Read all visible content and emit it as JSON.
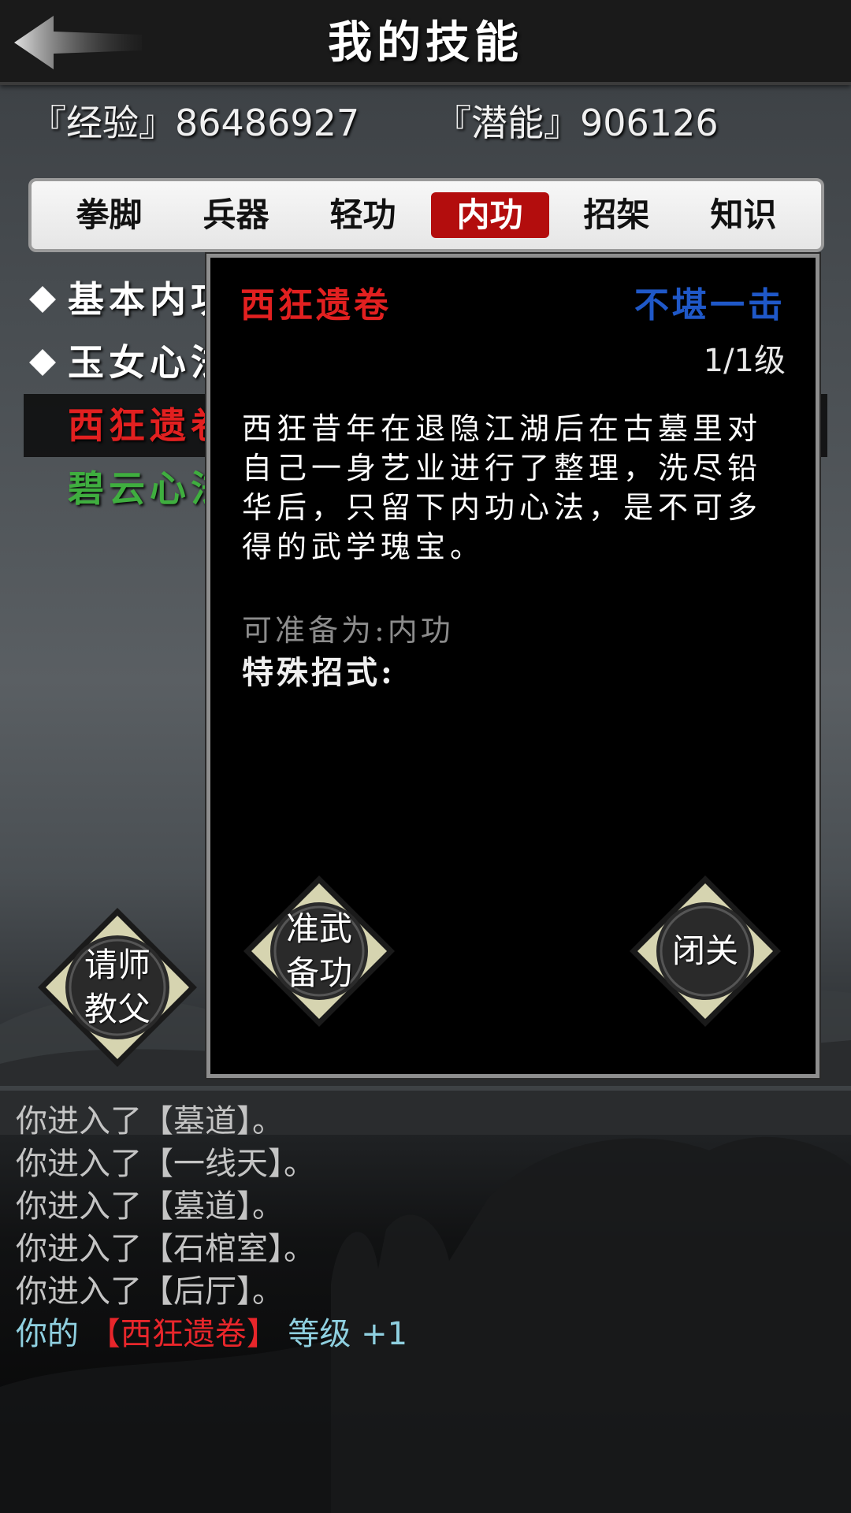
{
  "header": {
    "title": "我的技能"
  },
  "stats": {
    "experience_label": "『经验』",
    "experience_value": "86486927",
    "potential_label": "『潜能』",
    "potential_value": "906126"
  },
  "tabs": [
    {
      "label": "拳脚",
      "active": false
    },
    {
      "label": "兵器",
      "active": false
    },
    {
      "label": "轻功",
      "active": false
    },
    {
      "label": "内功",
      "active": true
    },
    {
      "label": "招架",
      "active": false
    },
    {
      "label": "知识",
      "active": false
    }
  ],
  "skills": [
    {
      "name": "基本内功",
      "color": "#ffffff",
      "bullet": true
    },
    {
      "name": "玉女心法",
      "color": "#ffffff",
      "bullet": true
    },
    {
      "name": "西狂遗卷",
      "color": "#e22020",
      "bullet": false,
      "selected": true
    },
    {
      "name": "碧云心法",
      "color": "#3fae3f",
      "bullet": false
    }
  ],
  "teacher_button": {
    "line1": "请师",
    "line2": "教父"
  },
  "popup": {
    "name": "西狂遗卷",
    "rank": "不堪一击",
    "level": "1/1级",
    "description": "西狂昔年在退隐江湖后在古墓里对自己一身艺业进行了整理，洗尽铅华后，只留下内功心法，是不可多得的武学瑰宝。",
    "prep_text": "可准备为:内功",
    "special_label": "特殊招式:",
    "prep_button": {
      "line1": "准武",
      "line2": "备功"
    },
    "close_button": {
      "label": "闭关"
    }
  },
  "log": {
    "lines": [
      "你进入了【墓道】。",
      "你进入了【一线天】。",
      "你进入了【墓道】。",
      "你进入了【石棺室】。",
      "你进入了【后厅】。"
    ],
    "last_prefix": "你的 ",
    "last_skill": "【西狂遗卷】",
    "last_suffix": " 等级 +1"
  },
  "colors": {
    "active_tab": "#b30d0d",
    "skill_red": "#e22020",
    "skill_green": "#3fae3f",
    "rank_blue": "#1f58c8",
    "log_cyan": "#8fd0e0"
  }
}
